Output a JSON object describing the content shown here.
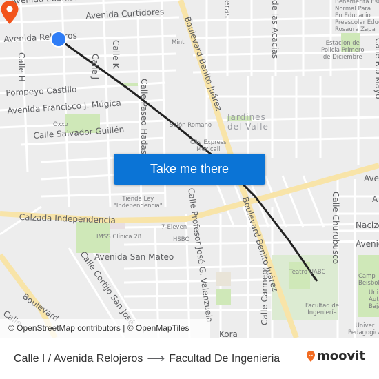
{
  "map": {
    "streets": [
      {
        "id": "av-ebanistas",
        "text": "Avenida Ebanistas"
      },
      {
        "id": "av-curtidores",
        "text": "Avenida Curtidores"
      },
      {
        "id": "av-relojeros",
        "text": "Avenida Relojeros"
      },
      {
        "id": "calle-h",
        "text": "Calle H"
      },
      {
        "id": "calle-j",
        "text": "Calle J"
      },
      {
        "id": "calle-k",
        "text": "Calle K"
      },
      {
        "id": "pompeyo",
        "text": "Pompeyo Castillo"
      },
      {
        "id": "mugica",
        "text": "Avenida Francisco J. Múgica"
      },
      {
        "id": "guillen",
        "text": "Calle Salvador Guillén"
      },
      {
        "id": "paseo-hadas",
        "text": "Calle Paseo Hadas"
      },
      {
        "id": "benito-juarez-1",
        "text": "Boulevard Benito Juárez"
      },
      {
        "id": "benito-juarez-2",
        "text": "Boulevard Benito Juárez"
      },
      {
        "id": "acacias",
        "text": "de las Acacias"
      },
      {
        "id": "eras",
        "text": "eras"
      },
      {
        "id": "rio-mayo",
        "text": "Calle Río Mayo"
      },
      {
        "id": "calzada",
        "text": "Calzada Independencia"
      },
      {
        "id": "profesor",
        "text": "Calle Profesor José G. Valenzuela"
      },
      {
        "id": "san-mateo",
        "text": "Avenida San Mateo"
      },
      {
        "id": "cortijo",
        "text": "Calle Cortijo San José"
      },
      {
        "id": "boulevard-sw",
        "text": "Boulevard"
      },
      {
        "id": "calle-sw",
        "text": "Calle"
      },
      {
        "id": "carmen",
        "text": "Calle Carmen"
      },
      {
        "id": "churubusco",
        "text": "Calle Churubusco"
      },
      {
        "id": "kora",
        "text": "Kora"
      },
      {
        "id": "ave-e1",
        "text": "Ave"
      },
      {
        "id": "ave-e2",
        "text": "A"
      },
      {
        "id": "nacizo",
        "text": "Nacizo"
      },
      {
        "id": "avenid-e",
        "text": "Avenid"
      }
    ],
    "pois": [
      {
        "id": "mint",
        "text": "Mint"
      },
      {
        "id": "oxxo",
        "text": "Oxxo"
      },
      {
        "id": "salon",
        "text": "Salón Romano"
      },
      {
        "id": "city-express",
        "text": "City Express\nMexicali"
      },
      {
        "id": "tienda-ley",
        "text": "Tienda Ley\n\"Independencia\""
      },
      {
        "id": "seven",
        "text": "7-Eleven"
      },
      {
        "id": "imss",
        "text": "IMSS Clínica 28"
      },
      {
        "id": "hsbc",
        "text": "HSBC"
      },
      {
        "id": "benemerita",
        "text": "Benemerita Esc\nNormal Para\nEn Educacio\nPreescolar Educ\nRosaura Zapa"
      },
      {
        "id": "policia",
        "text": "Estacion de\nPolicia Primero\nde Diciembre"
      },
      {
        "id": "teatro",
        "text": "Teatro UABC"
      },
      {
        "id": "facultad",
        "text": "Facultad de\nIngeniería"
      },
      {
        "id": "campo",
        "text": "Camp\nBeisbol"
      },
      {
        "id": "uni-aut",
        "text": "Uni\nAut\nBaja"
      },
      {
        "id": "uni-ped",
        "text": "Univer\nPedagogica"
      }
    ],
    "neighborhood": "Jardines\ndel Valle",
    "attribution": "© OpenStreetMap contributors | © OpenMapTiles",
    "cta_label": "Take me there",
    "colors": {
      "route": "#222222",
      "origin": "#2f7df6",
      "destination": "#f2541b",
      "button": "#0b74d6",
      "major_road": "#f8e4a8",
      "park": "#cfe8b8"
    }
  },
  "footer": {
    "origin": "Calle I / Avenida Relojeros",
    "arrow": "⟶",
    "destination": "Facultad De Ingenieria",
    "brand": "moovit",
    "brand_color": "#f26b21"
  }
}
